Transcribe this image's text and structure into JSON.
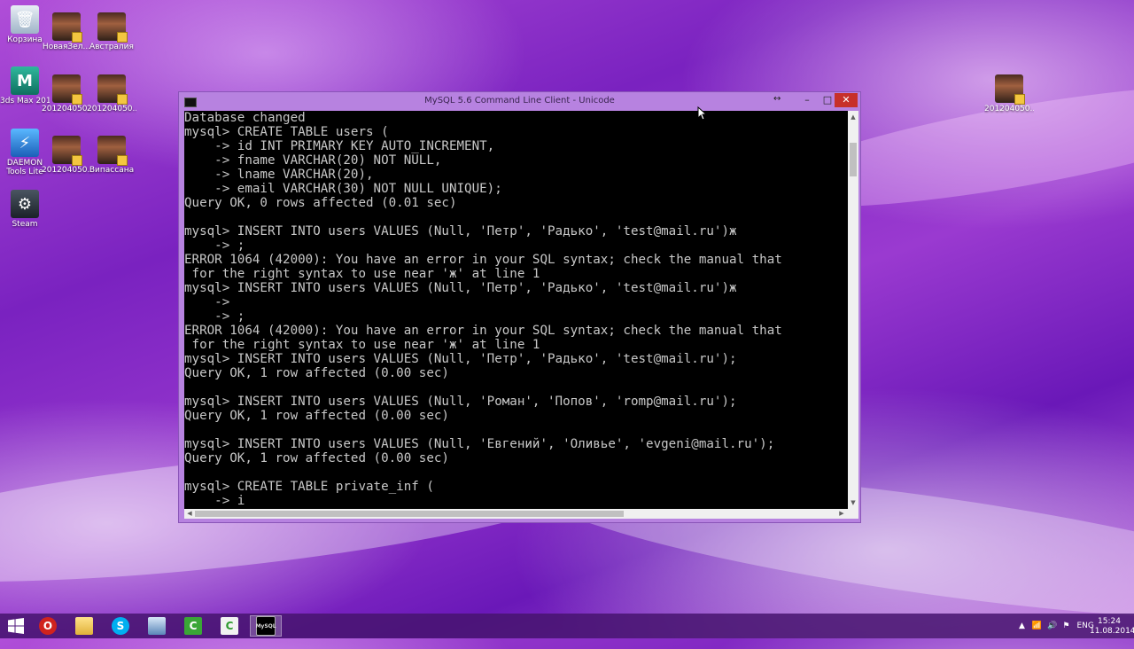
{
  "desktop": {
    "icons": [
      {
        "label": "Корзина"
      },
      {
        "label": "НоваяЗел..."
      },
      {
        "label": "Австралия"
      },
      {
        "label": "3ds Max 2014"
      },
      {
        "label": "201204050..."
      },
      {
        "label": "201204050..."
      },
      {
        "label": "DAEMON Tools Lite"
      },
      {
        "label": "201204050..."
      },
      {
        "label": "Випассана"
      },
      {
        "label": "Steam"
      },
      {
        "label": "201204050..."
      }
    ]
  },
  "window": {
    "title": "MySQL 5.6 Command Line Client - Unicode",
    "minimize_glyph": "–",
    "maximize_glyph": "□",
    "close_glyph": "✕",
    "console_lines": "Database changed\nmysql> CREATE TABLE users (\n    -> id INT PRIMARY KEY AUTO_INCREMENT,\n    -> fname VARCHAR(20) NOT NULL,\n    -> lname VARCHAR(20),\n    -> email VARCHAR(30) NOT NULL UNIQUE);\nQuery OK, 0 rows affected (0.01 sec)\n\nmysql> INSERT INTO users VALUES (Null, 'Петр', 'Радько', 'test@mail.ru')ж\n    -> ;\nERROR 1064 (42000): You have an error in your SQL syntax; check the manual that\n for the right syntax to use near 'ж' at line 1\nmysql> INSERT INTO users VALUES (Null, 'Петр', 'Радько', 'test@mail.ru')ж\n    ->\n    -> ;\nERROR 1064 (42000): You have an error in your SQL syntax; check the manual that\n for the right syntax to use near 'ж' at line 1\nmysql> INSERT INTO users VALUES (Null, 'Петр', 'Радько', 'test@mail.ru');\nQuery OK, 1 row affected (0.00 sec)\n\nmysql> INSERT INTO users VALUES (Null, 'Роман', 'Попов', 'romp@mail.ru');\nQuery OK, 1 row affected (0.00 sec)\n\nmysql> INSERT INTO users VALUES (Null, 'Евгений', 'Оливье', 'evgeni@mail.ru');\nQuery OK, 1 row affected (0.00 sec)\n\nmysql> CREATE TABLE private_inf (\n    -> i"
  },
  "taskbar": {
    "apps": [
      {
        "icon": "windows-start-icon"
      },
      {
        "icon": "opera-icon",
        "glyph": "O"
      },
      {
        "icon": "folder-icon",
        "glyph": ""
      },
      {
        "icon": "skype-icon",
        "glyph": "S"
      },
      {
        "icon": "scanner-icon",
        "glyph": ""
      },
      {
        "icon": "camtasia-recorder-icon",
        "glyph": "C"
      },
      {
        "icon": "camtasia-studio-icon",
        "glyph": "C"
      },
      {
        "icon": "mysql-console-icon",
        "glyph": "MySQL"
      }
    ],
    "language": "ENG",
    "time": "15:24",
    "date": "11.08.2014"
  },
  "colors": {
    "console_bg": "#000000",
    "console_fg": "#c8c8c8",
    "window_frame": "#b782e0",
    "close_button": "#c7302a"
  }
}
